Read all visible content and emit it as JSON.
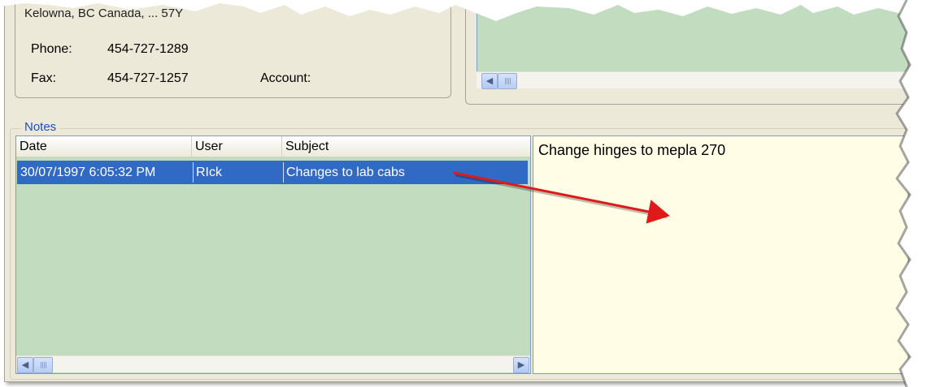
{
  "address": {
    "line": "Kelowna, BC  Canada, ... 57Y",
    "phone_label": "Phone:",
    "phone": "454-727-1289",
    "fax_label": "Fax:",
    "fax": "454-727-1257",
    "account_label": "Account:",
    "account": ""
  },
  "notes": {
    "group_label": "Notes",
    "columns": [
      "Date",
      "User",
      "Subject"
    ],
    "rows": [
      {
        "date": "30/07/1997 6:05:32 PM",
        "user": "RIck",
        "subject": "Changes to lab cabs"
      }
    ],
    "memo_text": "Change hinges to mepla 270"
  },
  "colors": {
    "panel": "#ece9d8",
    "list_green": "#c1dcbf",
    "selection": "#316ac5",
    "memo_bg": "#fffde6",
    "arrow": "#e0191a",
    "group_label": "#1c4fbf"
  },
  "icons": {
    "scroll_left": "scroll-left-arrow-icon",
    "scroll_right": "scroll-right-arrow-icon",
    "annotation_arrow": "red-annotation-arrow-icon"
  }
}
